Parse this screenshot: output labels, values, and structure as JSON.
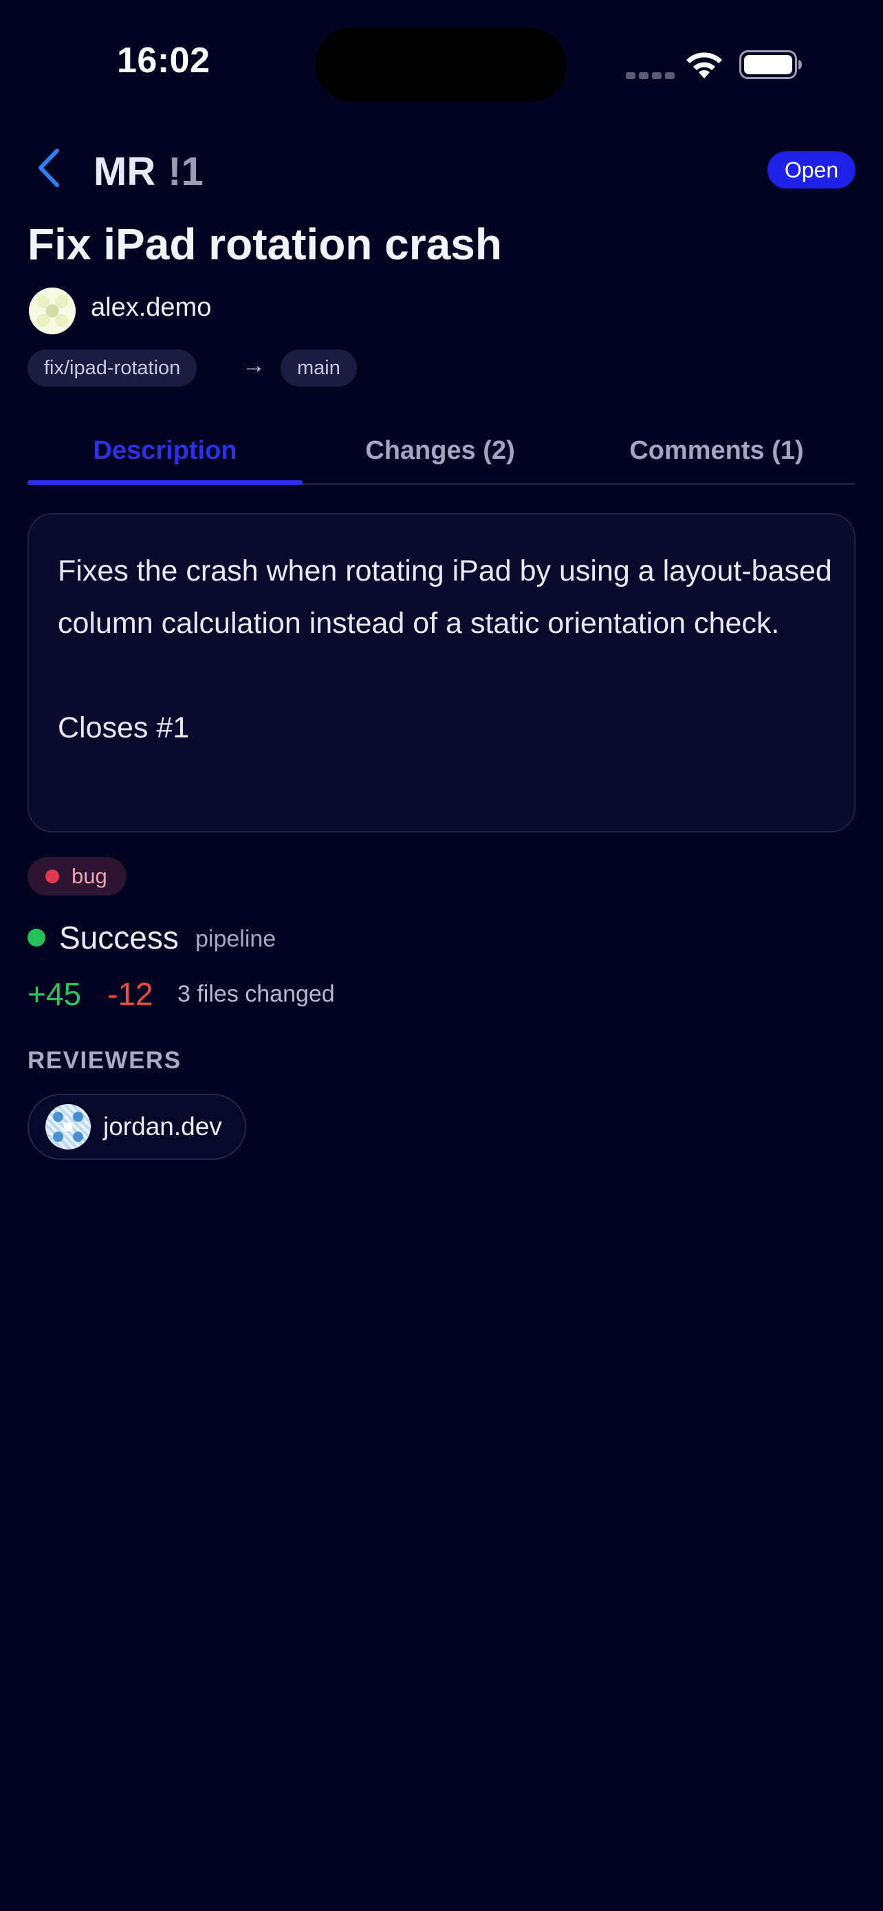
{
  "status_bar": {
    "time": "16:02"
  },
  "header": {
    "prefix": "MR",
    "number": "!1",
    "state_badge": "Open"
  },
  "merge_request": {
    "title": "Fix iPad rotation crash",
    "author": "alex.demo",
    "source_branch": "fix/ipad-rotation",
    "branch_arrow": "→",
    "target_branch": "main",
    "description": "Fixes the crash when rotating iPad by using a layout-based column calculation instead of a static orientation check.\n\nCloses #1",
    "labels": [
      {
        "name": "bug",
        "color": "#e0394f"
      }
    ],
    "pipeline": {
      "status": "Success",
      "label": "pipeline",
      "status_color": "#22c15a"
    },
    "diff_stats": {
      "additions": "+45",
      "deletions": "-12",
      "files_changed": "3 files changed"
    }
  },
  "tabs": [
    {
      "label": "Description",
      "active": true
    },
    {
      "label": "Changes (2)",
      "active": false
    },
    {
      "label": "Comments (1)",
      "active": false
    }
  ],
  "reviewers": {
    "heading": "REVIEWERS",
    "items": [
      {
        "name": "jordan.dev"
      }
    ]
  },
  "colors": {
    "background": "#030322",
    "accent": "#1e22e6",
    "additions": "#2dc25f",
    "deletions": "#ec4b44"
  },
  "icons": {
    "back": "chevron-left-icon",
    "wifi": "wifi-icon",
    "battery": "battery-icon",
    "cellular": "cellular-signal-icon"
  }
}
